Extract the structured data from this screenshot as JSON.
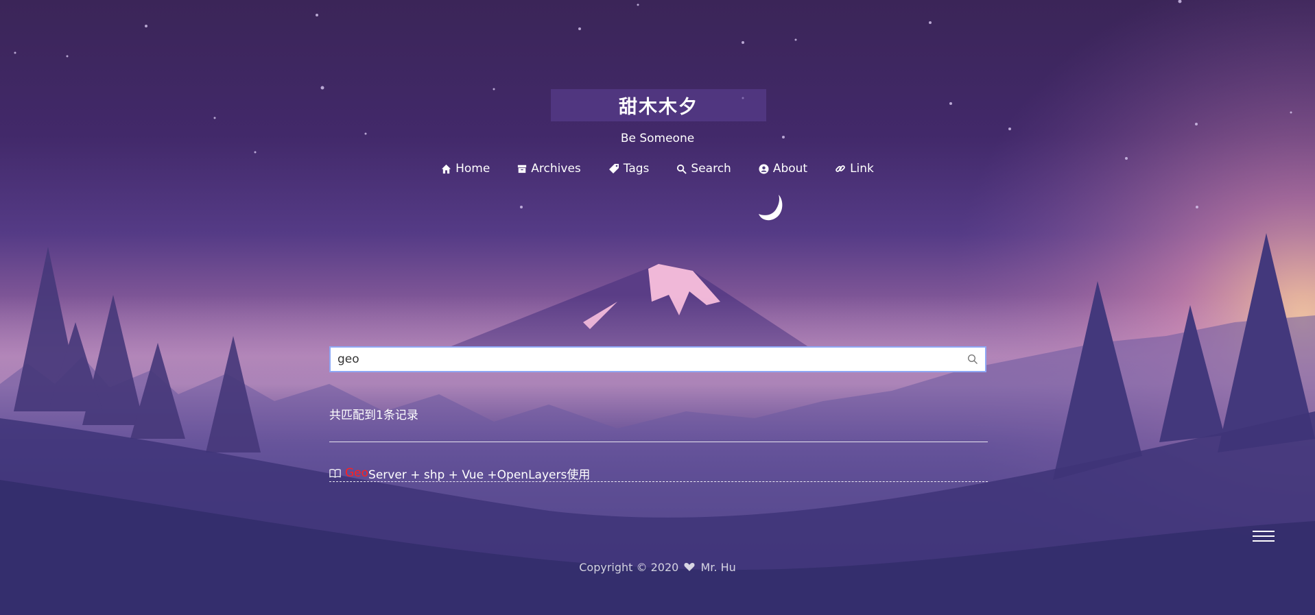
{
  "site": {
    "title": "甜木木夕",
    "subtitle": "Be Someone"
  },
  "nav": {
    "items": [
      {
        "label": "Home",
        "icon": "home-icon"
      },
      {
        "label": "Archives",
        "icon": "archive-icon"
      },
      {
        "label": "Tags",
        "icon": "tag-icon"
      },
      {
        "label": "Search",
        "icon": "search-icon"
      },
      {
        "label": "About",
        "icon": "user-icon"
      },
      {
        "label": "Link",
        "icon": "link-icon"
      }
    ]
  },
  "search": {
    "value": "geo",
    "icon": "search-icon"
  },
  "results": {
    "count_text": "共匹配到1条记录",
    "items": [
      {
        "highlight": "Geo",
        "rest": "Server + shp + Vue +OpenLayers使用",
        "icon": "book-icon"
      }
    ]
  },
  "footer": {
    "prefix": "Copyright © 2020",
    "icon": "heart-icon",
    "author": "Mr. Hu"
  },
  "colors": {
    "highlight": "#ff2020",
    "search_border": "#8fa8f5"
  }
}
